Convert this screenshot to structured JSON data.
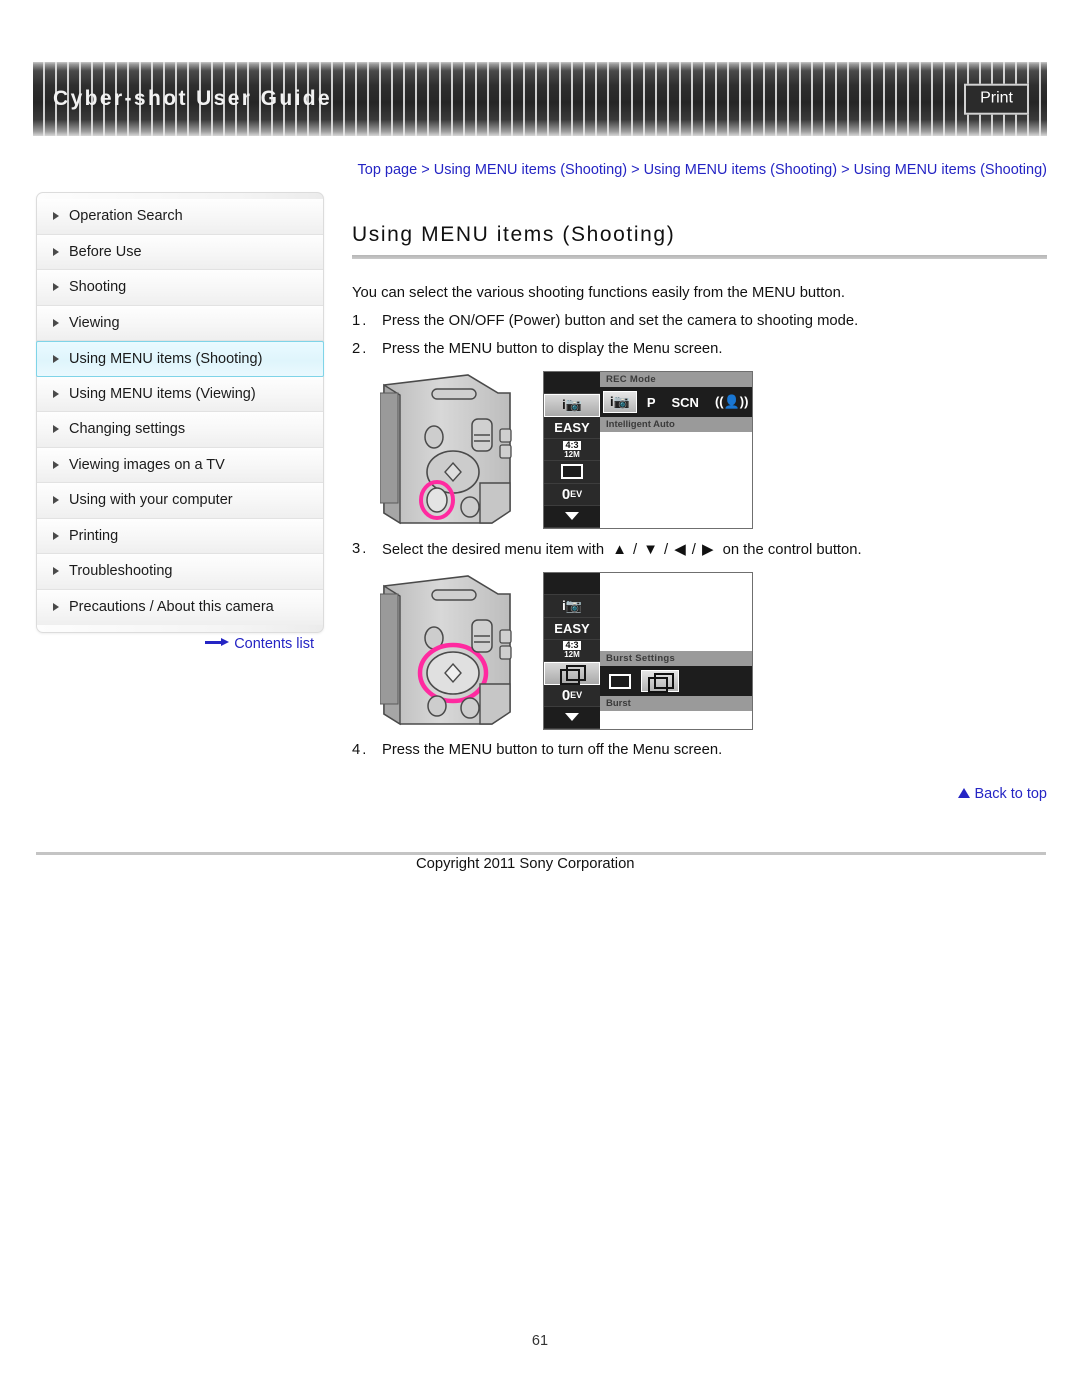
{
  "header": {
    "title": "Cyber-shot User Guide",
    "print_label": "Print"
  },
  "sidebar": {
    "items": [
      {
        "label": "Operation Search",
        "active": false
      },
      {
        "label": "Before Use",
        "active": false
      },
      {
        "label": "Shooting",
        "active": false
      },
      {
        "label": "Viewing",
        "active": false
      },
      {
        "label": "Using MENU items (Shooting)",
        "active": true
      },
      {
        "label": "Using MENU items (Viewing)",
        "active": false
      },
      {
        "label": "Changing settings",
        "active": false
      },
      {
        "label": "Viewing images on a TV",
        "active": false
      },
      {
        "label": "Using with your computer",
        "active": false
      },
      {
        "label": "Printing",
        "active": false
      },
      {
        "label": "Troubleshooting",
        "active": false
      },
      {
        "label": "Precautions / About this camera",
        "active": false
      }
    ],
    "contents_list_label": "Contents list"
  },
  "breadcrumb": {
    "crumb1": "Top page",
    "sep1": " > ",
    "crumb2": "Using MENU items (Shooting)",
    "sep2": " > ",
    "crumb3": "Using MENU items (Shooting)",
    "sep3": " > ",
    "crumb4": "Using MENU items (Shooting)"
  },
  "main": {
    "page_title": "Using MENU items (Shooting)",
    "intro": "You can select the various shooting functions easily from the MENU button.",
    "steps": [
      {
        "num": "1.",
        "text": "Press the ON/OFF (Power) button and set the camera to shooting mode."
      },
      {
        "num": "2.",
        "text": "Press the MENU button to display the Menu screen."
      },
      {
        "num": "3.",
        "text_before": "Select the desired menu item with",
        "arrows": "▲ / ▼ / ◀ / ▶",
        "text_after": "on the control button."
      },
      {
        "num": "4.",
        "text": "Press the MENU button to turn off the Menu screen."
      }
    ]
  },
  "figure1": {
    "caption_hint": "camera-rear-with-menu-button-highlighted",
    "lcd_left_icons": [
      "blank",
      "i📷",
      "EASY",
      "4:3 12M",
      "frame",
      "0EV",
      "down"
    ],
    "title_bar": "REC Mode",
    "modes": [
      "i📷",
      "P",
      "SCN",
      "((👤))"
    ],
    "selected_mode": "i📷",
    "label_bar": "Intelligent Auto"
  },
  "figure2": {
    "caption_hint": "camera-rear-with-control-button-highlighted",
    "lcd_left_icons": [
      "blank",
      "i📷",
      "EASY",
      "4:3 12M",
      "burst",
      "0EV",
      "down"
    ],
    "title_bar": "Burst Settings",
    "options": [
      "single",
      "burst"
    ],
    "selected_option": "burst",
    "label_bar": "Burst"
  },
  "footer": {
    "back_to_top": "Back to top",
    "copyright": "Copyright 2011 Sony Corporation",
    "page_number": "61"
  },
  "colors": {
    "link": "#2525c4",
    "highlight": "#dff5fc",
    "highlight_border": "#7fd4e8",
    "accent_pink": "#ff2aa0",
    "header_dark": "#262626"
  }
}
